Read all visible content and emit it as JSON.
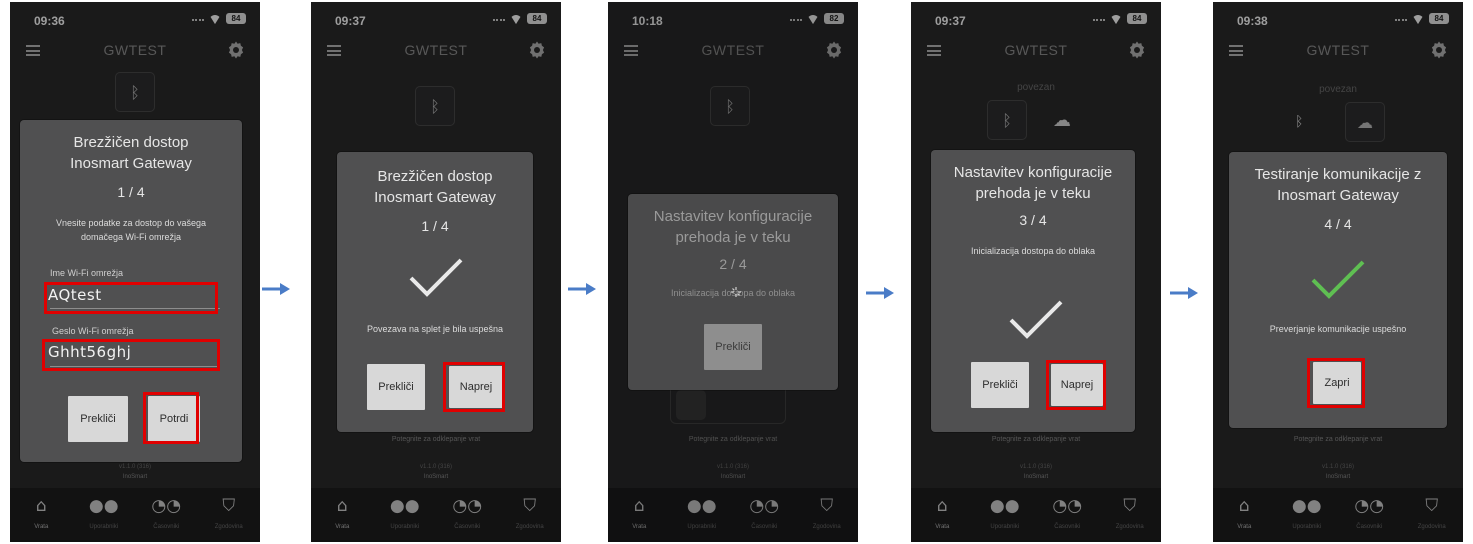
{
  "app": {
    "title": "GWTEST",
    "version": "v1.1.0 (316)",
    "brand": "InoSmart",
    "pull_hint": "Potegnite za odklepanje vrat",
    "connected": "povezan"
  },
  "tabs": [
    {
      "label": "Vrata",
      "icon": "home-icon"
    },
    {
      "label": "Uporabniki",
      "icon": "users-icon"
    },
    {
      "label": "Časovniki",
      "icon": "timers-icon"
    },
    {
      "label": "Zgodovina",
      "icon": "history-shield-icon"
    }
  ],
  "colors": {
    "highlight": "#e00000",
    "success_check": "#5fbf52",
    "arrow": "#4a7cc7",
    "modal": "#505051",
    "background": "#2a2a2b"
  },
  "screens": [
    {
      "time": "09:36",
      "battery": "84",
      "modal": {
        "title_line1": "Brezžičen dostop",
        "title_line2": "Inosmart Gateway",
        "step": "1 / 4",
        "text_line1": "Vnesite podatke za dostop do vašega",
        "text_line2": "domačega Wi-Fi omrežja",
        "ssid_label": "Ime Wi-Fi omrežja",
        "ssid_value": "AQtest",
        "password_label": "Geslo Wi-Fi omrežja",
        "password_value": "Ghht56ghj",
        "cancel_label": "Prekliči",
        "confirm_label": "Potrdi"
      }
    },
    {
      "time": "09:37",
      "battery": "84",
      "modal": {
        "title_line1": "Brezžičen dostop",
        "title_line2": "Inosmart Gateway",
        "step": "1 / 4",
        "text": "Povezava na splet je bila uspešna",
        "cancel_label": "Prekliči",
        "next_label": "Naprej"
      }
    },
    {
      "time": "10:18",
      "battery": "82",
      "modal": {
        "title_line1": "Nastavitev konfiguracije",
        "title_line2": "prehoda je v teku",
        "step": "2 / 4",
        "text": "Inicializacija dostopa do oblaka",
        "cancel_label": "Prekliči"
      }
    },
    {
      "time": "09:37",
      "battery": "84",
      "modal": {
        "title_line1": "Nastavitev konfiguracije",
        "title_line2": "prehoda je v teku",
        "step": "3 / 4",
        "text": "Inicializacija dostopa do oblaka",
        "cancel_label": "Prekliči",
        "next_label": "Naprej"
      }
    },
    {
      "time": "09:38",
      "battery": "84",
      "modal": {
        "title_line1": "Testiranje komunikacije z",
        "title_line2": "Inosmart Gateway",
        "step": "4 / 4",
        "text": "Preverjanje komunikacije uspešno",
        "close_label": "Zapri"
      }
    }
  ]
}
